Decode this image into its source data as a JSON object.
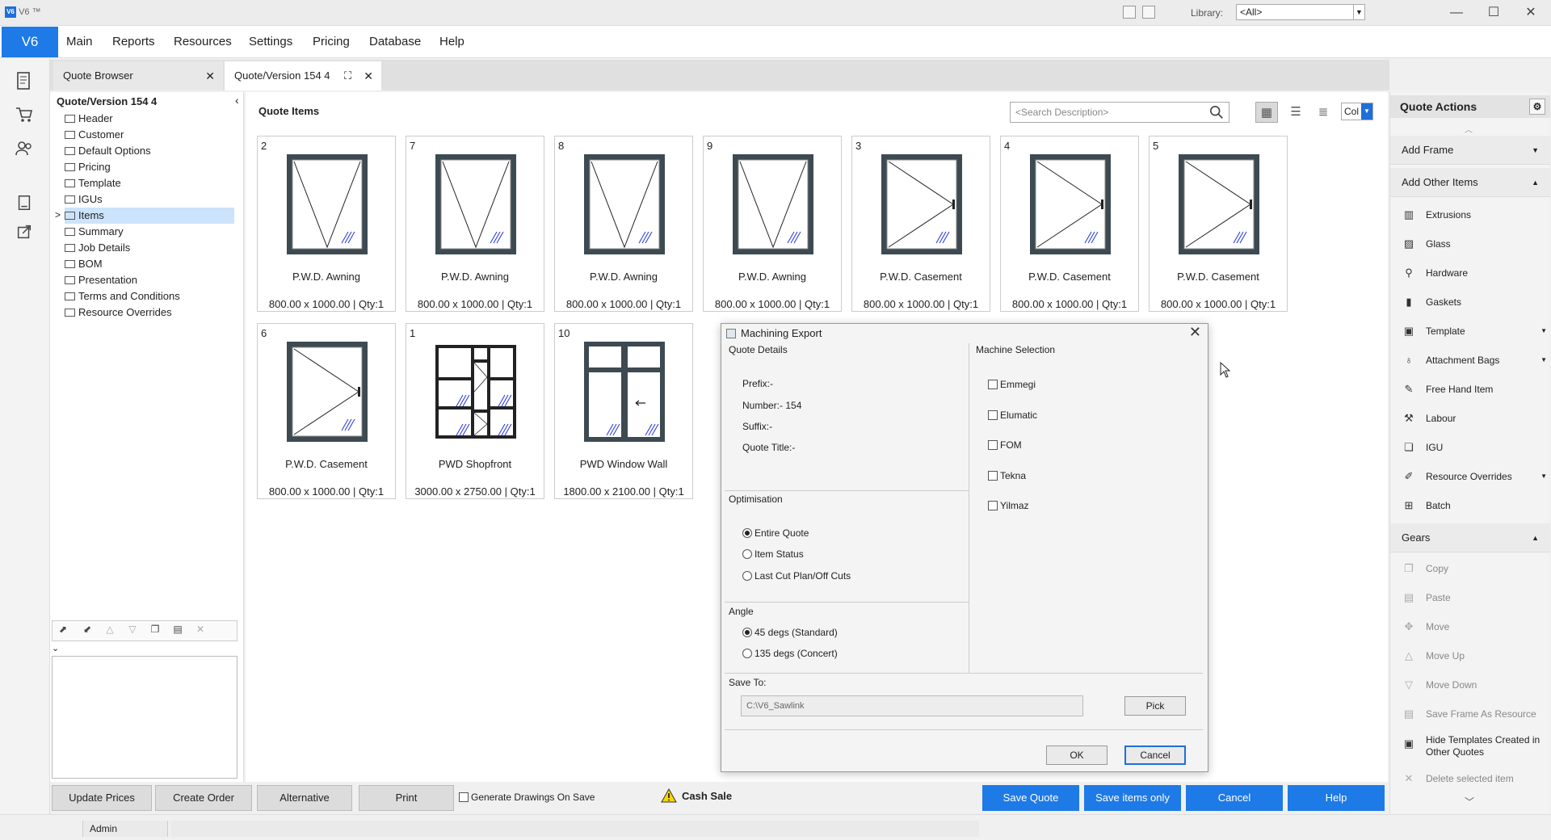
{
  "titlebar": {
    "app_label": "V6 ™",
    "library_label": "Library:",
    "library_value": "<All>",
    "minimize": "—",
    "maximize": "☐",
    "close": "✕"
  },
  "menubar": {
    "brand": "V6",
    "items": [
      "Main",
      "Reports",
      "Resources",
      "Settings",
      "Pricing",
      "Database",
      "Help"
    ]
  },
  "tabs": [
    {
      "label": "Quote Browser",
      "close": "✕"
    },
    {
      "label": "Quote/Version  154  4",
      "close": "✕"
    }
  ],
  "tree": {
    "title": "Quote/Version  154  4",
    "items": [
      "Header",
      "Customer",
      "Default Options",
      "Pricing",
      "Template",
      "IGUs",
      "Items",
      "Summary",
      "Job Details",
      "BOM",
      "Presentation",
      "Terms and Conditions",
      "Resource Overrides"
    ],
    "selected": "Items",
    "expander": ">"
  },
  "main": {
    "title": "Quote Items",
    "search_placeholder": "<Search Description>",
    "col_label": "Col",
    "cards": [
      {
        "num": "2",
        "name": "P.W.D. Awning",
        "size": "800.00 x 1000.00 | Qty:1",
        "kind": "awning"
      },
      {
        "num": "7",
        "name": "P.W.D. Awning",
        "size": "800.00 x 1000.00 | Qty:1",
        "kind": "awning"
      },
      {
        "num": "8",
        "name": "P.W.D. Awning",
        "size": "800.00 x 1000.00 | Qty:1",
        "kind": "awning"
      },
      {
        "num": "9",
        "name": "P.W.D. Awning",
        "size": "800.00 x 1000.00 | Qty:1",
        "kind": "awning"
      },
      {
        "num": "3",
        "name": "P.W.D. Casement",
        "size": "800.00 x 1000.00 | Qty:1",
        "kind": "casement"
      },
      {
        "num": "4",
        "name": "P.W.D. Casement",
        "size": "800.00 x 1000.00 | Qty:1",
        "kind": "casement"
      },
      {
        "num": "5",
        "name": "P.W.D. Casement",
        "size": "800.00 x 1000.00 | Qty:1",
        "kind": "casement"
      },
      {
        "num": "6",
        "name": "P.W.D. Casement",
        "size": "800.00 x 1000.00 | Qty:1",
        "kind": "casement"
      },
      {
        "num": "1",
        "name": "PWD Shopfront",
        "size": "3000.00 x 2750.00 | Qty:1",
        "kind": "shopfront"
      },
      {
        "num": "10",
        "name": "PWD Window Wall",
        "size": "1800.00 x 2100.00 | Qty:1",
        "kind": "windowwall"
      }
    ]
  },
  "dialog": {
    "title": "Machining Export",
    "close": "✕",
    "quote_details_label": "Quote Details",
    "prefix": "Prefix:-",
    "number": "Number:- 154",
    "suffix": "Suffix:-",
    "quote_title": "Quote Title:-",
    "optimisation_label": "Optimisation",
    "optimisation_options": [
      "Entire Quote",
      "Item Status",
      "Last Cut Plan/Off Cuts"
    ],
    "optimisation_selected": "Entire Quote",
    "angle_label": "Angle",
    "angle_options": [
      "45 degs (Standard)",
      "135 degs (Concert)"
    ],
    "angle_selected": "45 degs (Standard)",
    "machine_label": "Machine Selection",
    "machines": [
      "Emmegi",
      "Elumatic",
      "FOM",
      "Tekna",
      "Yilmaz"
    ],
    "save_to_label": "Save To:",
    "save_to_value": "C:\\V6_Sawlink",
    "pick_label": "Pick",
    "ok_label": "OK",
    "cancel_label": "Cancel"
  },
  "quote_actions": {
    "title": "Quote Actions",
    "add_frame": "Add Frame",
    "add_other": "Add Other Items",
    "other_items": [
      {
        "label": "Extrusions",
        "icon": "extrusion-icon",
        "sub": false
      },
      {
        "label": "Glass",
        "icon": "glass-icon",
        "sub": false
      },
      {
        "label": "Hardware",
        "icon": "hardware-icon",
        "sub": false
      },
      {
        "label": "Gaskets",
        "icon": "gasket-icon",
        "sub": false
      },
      {
        "label": "Template",
        "icon": "template-icon",
        "sub": true
      },
      {
        "label": "Attachment Bags",
        "icon": "bag-icon",
        "sub": true
      },
      {
        "label": "Free Hand Item",
        "icon": "freehand-icon",
        "sub": false
      },
      {
        "label": "Labour",
        "icon": "labour-icon",
        "sub": false
      },
      {
        "label": "IGU",
        "icon": "igu-icon",
        "sub": false
      },
      {
        "label": "Resource Overrides",
        "icon": "override-icon",
        "sub": true
      },
      {
        "label": "Batch",
        "icon": "batch-icon",
        "sub": false
      }
    ],
    "gears": "Gears",
    "gear_items": [
      "Copy",
      "Paste",
      "Move",
      "Move Up",
      "Move Down",
      "Save Frame As Resource",
      "Hide Templates Created in Other Quotes",
      "Delete selected item"
    ]
  },
  "bottombar": {
    "update_prices": "Update Prices",
    "create_order": "Create Order",
    "alternative": "Alternative",
    "print": "Print",
    "generate_drawings": "Generate Drawings On Save",
    "cash_sale": "Cash Sale",
    "save_quote": "Save Quote",
    "save_items_only": "Save items only",
    "cancel": "Cancel",
    "help": "Help"
  },
  "status": {
    "user": "Admin"
  },
  "colors": {
    "accent": "#1e7ae6",
    "selection": "#cce4fb",
    "frame": "#3d4a52",
    "glass_hatch": "#2233dd"
  }
}
